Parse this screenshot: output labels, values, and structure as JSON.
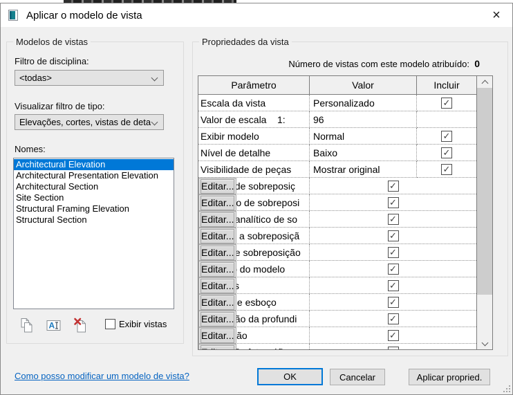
{
  "titlebar": {
    "title": "Aplicar o modelo de vista"
  },
  "left_panel": {
    "group_title": "Modelos de vistas",
    "discipline_filter_label": "Filtro de disciplina:",
    "discipline_filter_value": "<todas>",
    "type_filter_label": "Visualizar filtro de tipo:",
    "type_filter_value": "Elevações, cortes, vistas de deta",
    "names_label": "Nomes:",
    "names": [
      "Architectural Elevation",
      "Architectural Presentation Elevation",
      "Architectural Section",
      "Site Section",
      "Structural Framing Elevation",
      "Structural Section"
    ],
    "selected_name": "Architectural Elevation",
    "show_views_label": "Exibir vistas",
    "show_views_checked": false
  },
  "right_panel": {
    "group_title": "Propriedades da vista",
    "assigned_count_label": "Número de vistas com este modelo atribuído:  ",
    "assigned_count": "0",
    "table": {
      "headers": [
        "Parâmetro",
        "Valor",
        "Incluir"
      ],
      "rows": [
        {
          "param": "Escala da vista",
          "value": "Personalizado",
          "value_type": "text",
          "include": "checked"
        },
        {
          "param": "Valor de escala    1:",
          "value": "96",
          "value_type": "text",
          "include": "none"
        },
        {
          "param": "Exibir modelo",
          "value": "Normal",
          "value_type": "text",
          "include": "checked"
        },
        {
          "param": "Nível de detalhe",
          "value": "Baixo",
          "value_type": "text",
          "include": "checked"
        },
        {
          "param": "Visibilidade de peças",
          "value": "Mostrar original",
          "value_type": "text",
          "include": "checked"
        },
        {
          "param": "Modelo de sobreposiç",
          "value": "Editar...",
          "value_type": "button",
          "include": "checked"
        },
        {
          "param": "Anotação de sobreposi",
          "value": "Editar...",
          "value_type": "button",
          "include": "checked"
        },
        {
          "param": "Modelo analítico de so",
          "value": "Editar...",
          "value_type": "button",
          "include": "checked"
        },
        {
          "param": "Importar a sobreposiçã",
          "value": "Editar...",
          "value_type": "button",
          "include": "checked"
        },
        {
          "param": "Filtros de sobreposição",
          "value": "Editar...",
          "value_type": "button",
          "include": "checked"
        },
        {
          "param": "Exibição do modelo",
          "value": "Editar...",
          "value_type": "button",
          "include": "checked"
        },
        {
          "param": "Sombras",
          "value": "Editar...",
          "value_type": "button",
          "include": "checked"
        },
        {
          "param": "Linhas de esboço",
          "value": "Editar...",
          "value_type": "button",
          "include": "checked"
        },
        {
          "param": "Simulação da profundi",
          "value": "Editar...",
          "value_type": "button",
          "include": "checked"
        },
        {
          "param": "Iluminação",
          "value": "Editar...",
          "value_type": "button",
          "include": "checked"
        },
        {
          "param": "Exposição fotográfica",
          "value": "Editar...",
          "value_type": "button",
          "include": "checked"
        }
      ]
    }
  },
  "footer": {
    "help_link": "Como posso modificar um modelo de vista?",
    "ok_label": "OK",
    "cancel_label": "Cancelar",
    "apply_label": "Aplicar propried."
  },
  "icons": {
    "titlebar": "view-template-icon",
    "close": "close-icon",
    "toolbar": [
      "duplicate-icon",
      "rename-icon",
      "delete-icon"
    ],
    "combos": "chevron-down-icon",
    "scrollbar": [
      "chevron-up-icon",
      "chevron-down-icon"
    ],
    "resize": "resize-grip"
  },
  "colors": {
    "accent": "#0078d7",
    "selection_bg": "#0078d7",
    "link": "#0563c1",
    "dialog_bg": "#f0f0f0",
    "titlebar_bg": "#ffffff"
  },
  "checkmark_glyph": "✓"
}
